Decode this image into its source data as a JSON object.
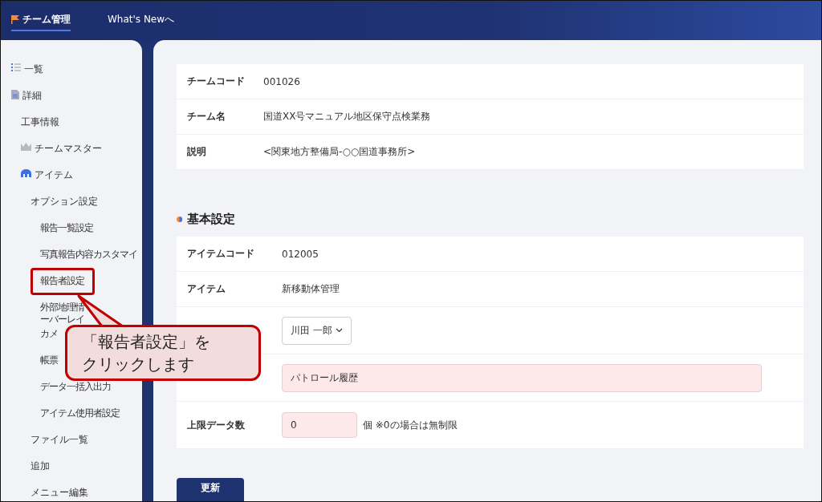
{
  "header": {
    "tabs": [
      {
        "label": "チーム管理",
        "selected": true
      },
      {
        "label": "What's Newへ",
        "selected": false
      }
    ]
  },
  "sidebar": {
    "items": [
      {
        "label": "一覧",
        "kind": "list"
      },
      {
        "label": "詳細",
        "kind": "doc",
        "children": [
          {
            "label": "工事情報"
          },
          {
            "label": "チームマスター",
            "kind": "crown"
          },
          {
            "label": "アイテム",
            "kind": "item",
            "children": [
              {
                "label": "オプション設定",
                "children": [
                  {
                    "label": "報告一覧設定"
                  },
                  {
                    "label": "写真報告内容カスタマイ"
                  },
                  {
                    "label": "報告者設定"
                  },
                  {
                    "parts": [
                      "外部地理情",
                      "ーバーレイ"
                    ]
                  },
                  {
                    "label": "カメ"
                  },
                  {
                    "label": "帳票"
                  },
                  {
                    "label": "データ一括入出力"
                  },
                  {
                    "label": "アイテム使用者設定"
                  }
                ]
              },
              {
                "label": "ファイル一覧"
              },
              {
                "label": "追加"
              },
              {
                "label": "メニュー編集"
              }
            ]
          }
        ]
      }
    ]
  },
  "team": [
    {
      "label": "チームコード",
      "value": "001026"
    },
    {
      "label": "チーム名",
      "value": "国道XX号マニュアル地区保守点検業務"
    },
    {
      "label": "説明",
      "value": "<関東地方整備局-○○国道事務所>"
    }
  ],
  "basic": {
    "title": "基本設定",
    "rows": [
      {
        "kind": "text",
        "label": "アイテムコード",
        "value": "012005"
      },
      {
        "kind": "text",
        "label": "アイテム",
        "value": "新移動体管理"
      },
      {
        "kind": "select",
        "value": "川田 一郎"
      },
      {
        "kind": "input",
        "value": "パトロール履歴"
      },
      {
        "kind": "number",
        "label": "上限データ数",
        "value": "0",
        "suffix": "個  ※0の場合は無制限"
      }
    ]
  },
  "update_button": "更新",
  "callout": {
    "lines": [
      "「報告者設定」を",
      "クリックします"
    ]
  }
}
